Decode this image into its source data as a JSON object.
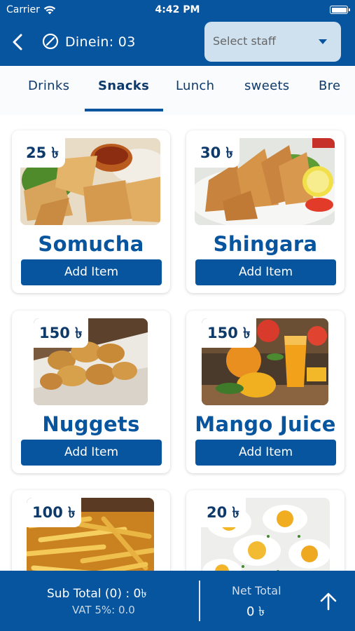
{
  "status_bar": {
    "carrier": "Carrier",
    "time": "4:42 PM"
  },
  "header": {
    "back_icon": "chevron-left-icon",
    "table_icon": "prohibited-circle-icon",
    "dinein_label": "Dinein: 03",
    "staff_select": {
      "placeholder": "Select staff",
      "caret_icon": "caret-down-icon"
    }
  },
  "tabs": [
    {
      "label": "Drinks",
      "active": false
    },
    {
      "label": "Snacks",
      "active": true
    },
    {
      "label": "Lunch",
      "active": false
    },
    {
      "label": "sweets",
      "active": false
    },
    {
      "label": "Bre",
      "active": false
    }
  ],
  "items": [
    {
      "price": "25 ৳",
      "name": "Somucha",
      "button": "Add Item",
      "image": "somucha-photo"
    },
    {
      "price": "30 ৳",
      "name": "Shingara",
      "button": "Add Item",
      "image": "shingara-photo"
    },
    {
      "price": "150 ৳",
      "name": "Nuggets",
      "button": "Add Item",
      "image": "nuggets-photo"
    },
    {
      "price": "150 ৳",
      "name": "Mango Juice",
      "button": "Add Item",
      "image": "mango-juice-photo"
    },
    {
      "price": "100 ৳",
      "name": "",
      "button": "",
      "image": "fries-photo"
    },
    {
      "price": "20 ৳",
      "name": "",
      "button": "",
      "image": "boiled-eggs-photo"
    }
  ],
  "footer": {
    "subtotal": "Sub Total (0)  : 0৳",
    "vat": "VAT 5%: 0.0",
    "net_total_label": "Net Total",
    "net_total_value": "0 ৳",
    "arrow_icon": "arrow-up-icon"
  },
  "colors": {
    "primary": "#07559e",
    "select_bg": "#cfe0ef",
    "tab_bg": "#f9fbfd"
  }
}
